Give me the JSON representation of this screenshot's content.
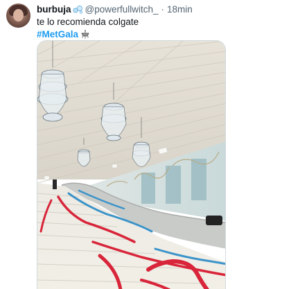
{
  "tweet": {
    "display_name": "burbuja",
    "handle": "@powerfullwitch_",
    "separator": "·",
    "time": "18min",
    "text": "te lo recomienda colgate",
    "hashtag": "#MetGala",
    "emoji_icon": "chandelier-icon"
  },
  "icons": {
    "verified": "bubbles-icon",
    "avatar": "avatar-photo"
  },
  "colors": {
    "text": "#0f1419",
    "secondary": "#536471",
    "link": "#1d9bf0",
    "stair_red": "#d8253a",
    "stair_blue": "#3a93c9"
  }
}
